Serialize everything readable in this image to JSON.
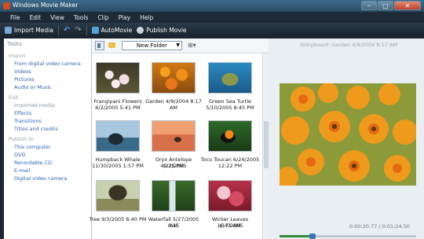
{
  "window": {
    "title": "Windows Movie Maker"
  },
  "menu": [
    "File",
    "Edit",
    "View",
    "Tools",
    "Clip",
    "Play",
    "Help"
  ],
  "toolbar": {
    "import": "Import Media",
    "automovie": "AutoMovie",
    "publish": "Publish Movie"
  },
  "tasks": {
    "header": "Tasks",
    "groups": [
      {
        "title": "Import",
        "links": [
          "From digital video camera",
          "Videos",
          "Pictures",
          "Audio or Music"
        ]
      },
      {
        "title": "Edit",
        "links": [
          "Imported media",
          "Effects",
          "Transitions",
          "Titles and credits"
        ]
      },
      {
        "title": "Publish to",
        "links": [
          "This computer",
          "DVD",
          "Recordable CD",
          "E-mail",
          "Digital video camera"
        ]
      }
    ]
  },
  "collection": {
    "folder_select": "New Folder",
    "items": [
      {
        "name": "Frangipani Flowers",
        "date": "6/2/2005 5:41 PM",
        "icon": "frangipani-photo"
      },
      {
        "name": "Garden 4/9/2004 8:17",
        "date": "AM",
        "icon": "garden-photo"
      },
      {
        "name": "Green Sea Turtle",
        "date": "5/10/2005 8:45 PM",
        "icon": "turtle-photo"
      },
      {
        "name": "Humpback Whale",
        "date": "11/30/2005 1:57 PM",
        "icon": "whale-photo"
      },
      {
        "name": "Oryx Antelope 4/22/2005",
        "date": "5:25 PM",
        "icon": "oryx-photo"
      },
      {
        "name": "Toco Toucan 6/24/2005",
        "date": "12:22 PM",
        "icon": "toucan-photo"
      },
      {
        "name": "Tree 9/3/2005 6:40 PM",
        "date": "",
        "icon": "tree-photo"
      },
      {
        "name": "Waterfall 5/27/2005 8:15",
        "date": "AM",
        "icon": "waterfall-photo"
      },
      {
        "name": "Winter Leaves 1/17/2005",
        "date": "6:43 AM",
        "icon": "leaves-photo"
      }
    ]
  },
  "preview": {
    "title": "Storyboard: Garden 4/9/2004 8:17 AM",
    "time": "0:00:20.77 / 0:01:24.50",
    "progress": 0.25
  },
  "colors": {
    "accent": "#2e8a34",
    "link": "#2f64b0"
  }
}
